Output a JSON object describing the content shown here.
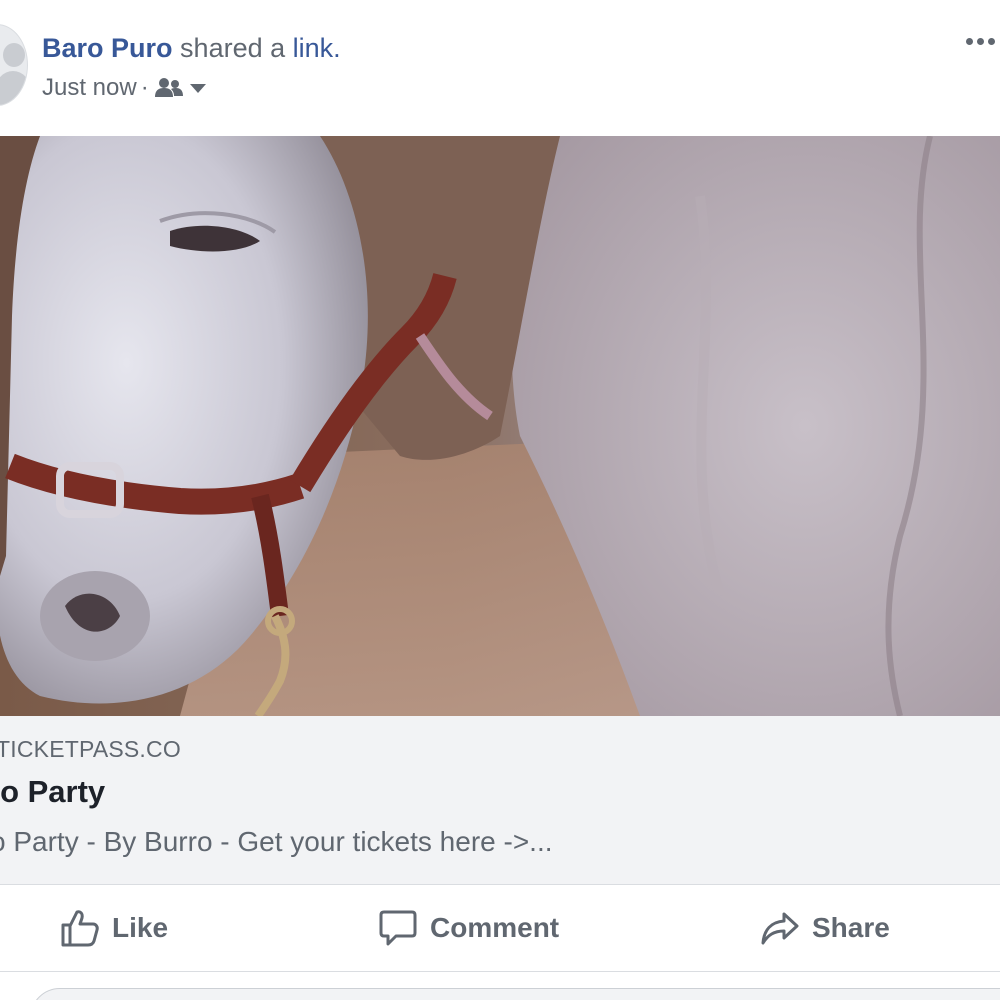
{
  "post": {
    "author": "Baro Puro",
    "action_text": "shared a",
    "action_link": "link.",
    "timestamp": "Just now",
    "separator": "·",
    "audience_icon": "friends-icon",
    "more_icon": "more-options-icon"
  },
  "link_preview": {
    "image_subject": "donkey-with-halter-photo",
    "domain": "TICKETPASS.CO",
    "title": "ro Party",
    "description": "o Party - By Burro - Get your tickets here ->..."
  },
  "actions": {
    "like_label": "Like",
    "comment_label": "Comment",
    "share_label": "Share"
  },
  "colors": {
    "link_blue": "#385898",
    "text_gray": "#606770",
    "caption_bg": "#f2f3f5",
    "divider": "#dadde1"
  }
}
